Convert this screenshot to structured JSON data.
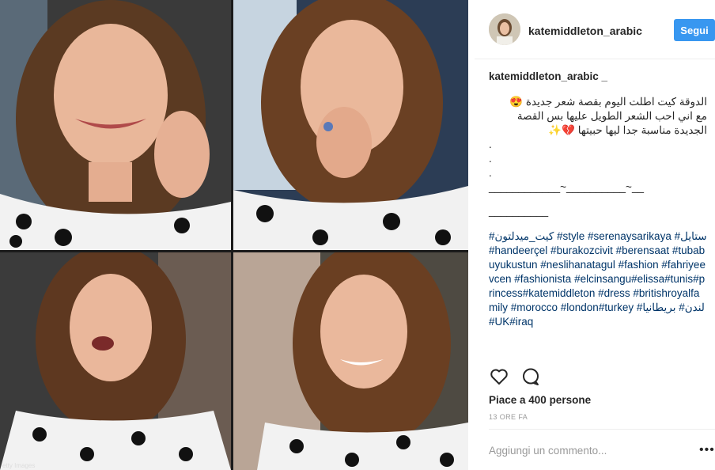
{
  "photo": {
    "credit": "etty Images"
  },
  "header": {
    "username": "katemiddleton_arabic",
    "follow_label": "Segui"
  },
  "caption": {
    "username": "katemiddleton_arabic _",
    "line1": "الدوقة كيت اطلت اليوم بقصة شعر جديدة 😍",
    "line2": "مع اني احب الشعر الطويل عليها بس القصة",
    "line3": "الجديدة مناسبة جدا ليها حبيتها 💔✨",
    "dot1": ".",
    "dot2": ".",
    "dot3": ".",
    "separator1": "____________~__________~__",
    "separator2": "__________",
    "hashtags": "#كيت_ميدلتون #style #serenaysarikaya #ستايل #handeerçel #burakozcivit #berensaat #tubabuyukustun #neslihanatagul #fashion #fahriyeevcen #fashionista #elcinsangu#elissa#tunis#princess#katemiddleton #dress #britishroyalfamily #morocco #london#turkey #لندن# بريطانيا #UK#iraq"
  },
  "actions": {
    "like_icon": "heart-outline-icon",
    "comment_icon": "speech-bubble-icon"
  },
  "likes": "Piace a 400 persone",
  "timestamp": "13 ORE FA",
  "comment_placeholder": "Aggiungi un commento...",
  "more_label": "•••",
  "colors": {
    "accent": "#3897f0",
    "link": "#003569",
    "muted": "#999999",
    "text": "#262626"
  }
}
